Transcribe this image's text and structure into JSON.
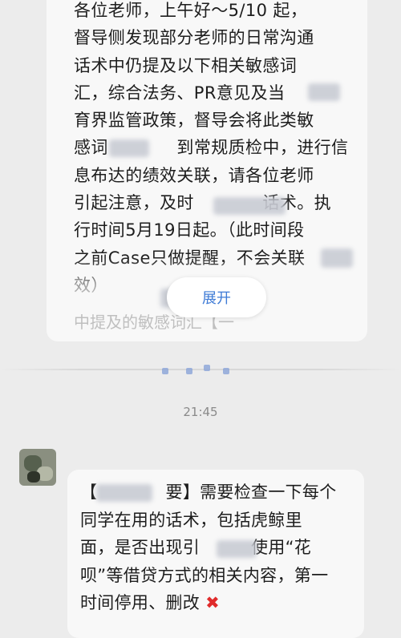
{
  "message1": {
    "lines": [
      "各位老师，上午好～5/10 起，",
      "督导侧发现部分老师的日常沟通",
      "话术中仍提及以下相关敏感词",
      "汇，综合法务、PR意见及当",
      "育界监管政策，督导会将此类敏",
      "感词",
      "到常规质检中，进行信",
      "息布达的绩效关联，请各位老师",
      "引起注意，及时",
      "话术。执",
      "行时间5月19日起。（此时间段",
      "之前Case只做提醒，不会关联",
      "效）"
    ],
    "expand_label": "展开",
    "quote_preview": "中提及的敏感词汇【一"
  },
  "timestamp": "21:45",
  "message2": {
    "lines": [
      "【",
      "要】需要检查一下每个",
      "同学在用的话术，包括虎鲸里",
      "面，是否出现引",
      "使用“花",
      "呗”等借贷方式的相关内容，第一",
      "时间停用、删改"
    ],
    "mark_glyph": "✖",
    "mark_color": "#e02b2b"
  }
}
